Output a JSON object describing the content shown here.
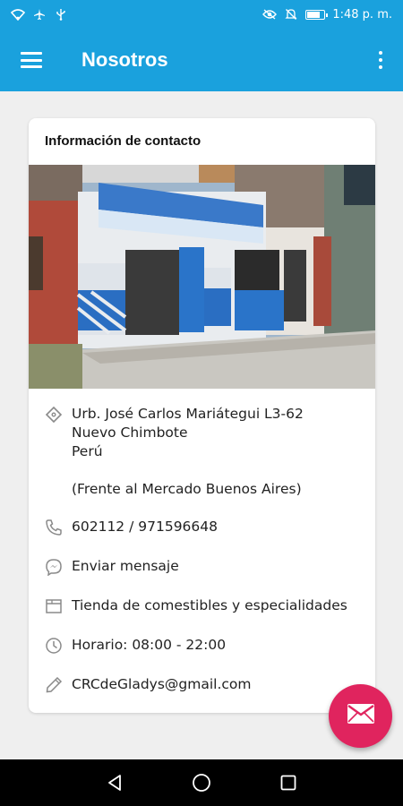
{
  "status_bar": {
    "time": "1:48 p. m.",
    "icons_left": [
      "wifi-icon",
      "airplane-icon",
      "usb-icon"
    ],
    "icons_right": [
      "eye-icon",
      "mute-icon",
      "battery-icon"
    ],
    "color": "#1aa1dd"
  },
  "app_bar": {
    "title": "Nosotros",
    "color": "#1aa1dd",
    "menu_icon": "hamburger-menu-icon",
    "overflow_icon": "more-vert-icon"
  },
  "card": {
    "title": "Información de contacto",
    "address": {
      "icon": "place-tag-icon",
      "lines": [
        "Urb. José Carlos Mariátegui L3-62",
        "Nuevo Chimbote",
        "Perú"
      ],
      "reference": "(Frente al Mercado Buenos Aires)"
    },
    "phone": {
      "icon": "phone-icon",
      "text": "602112 / 971596648"
    },
    "message": {
      "icon": "messenger-icon",
      "text": "Enviar mensaje"
    },
    "category": {
      "icon": "storefront-icon",
      "text": "Tienda de comestibles y especialidades"
    },
    "hours": {
      "icon": "clock-icon",
      "text": "Horario: 08:00 - 22:00"
    },
    "email": {
      "icon": "pencil-icon",
      "text": "CRCdeGladys@gmail.com"
    }
  },
  "fab": {
    "icon": "mail-icon",
    "color": "#e0245e"
  },
  "nav_bar": {
    "icons": [
      "back-icon",
      "home-icon",
      "recents-icon"
    ]
  }
}
